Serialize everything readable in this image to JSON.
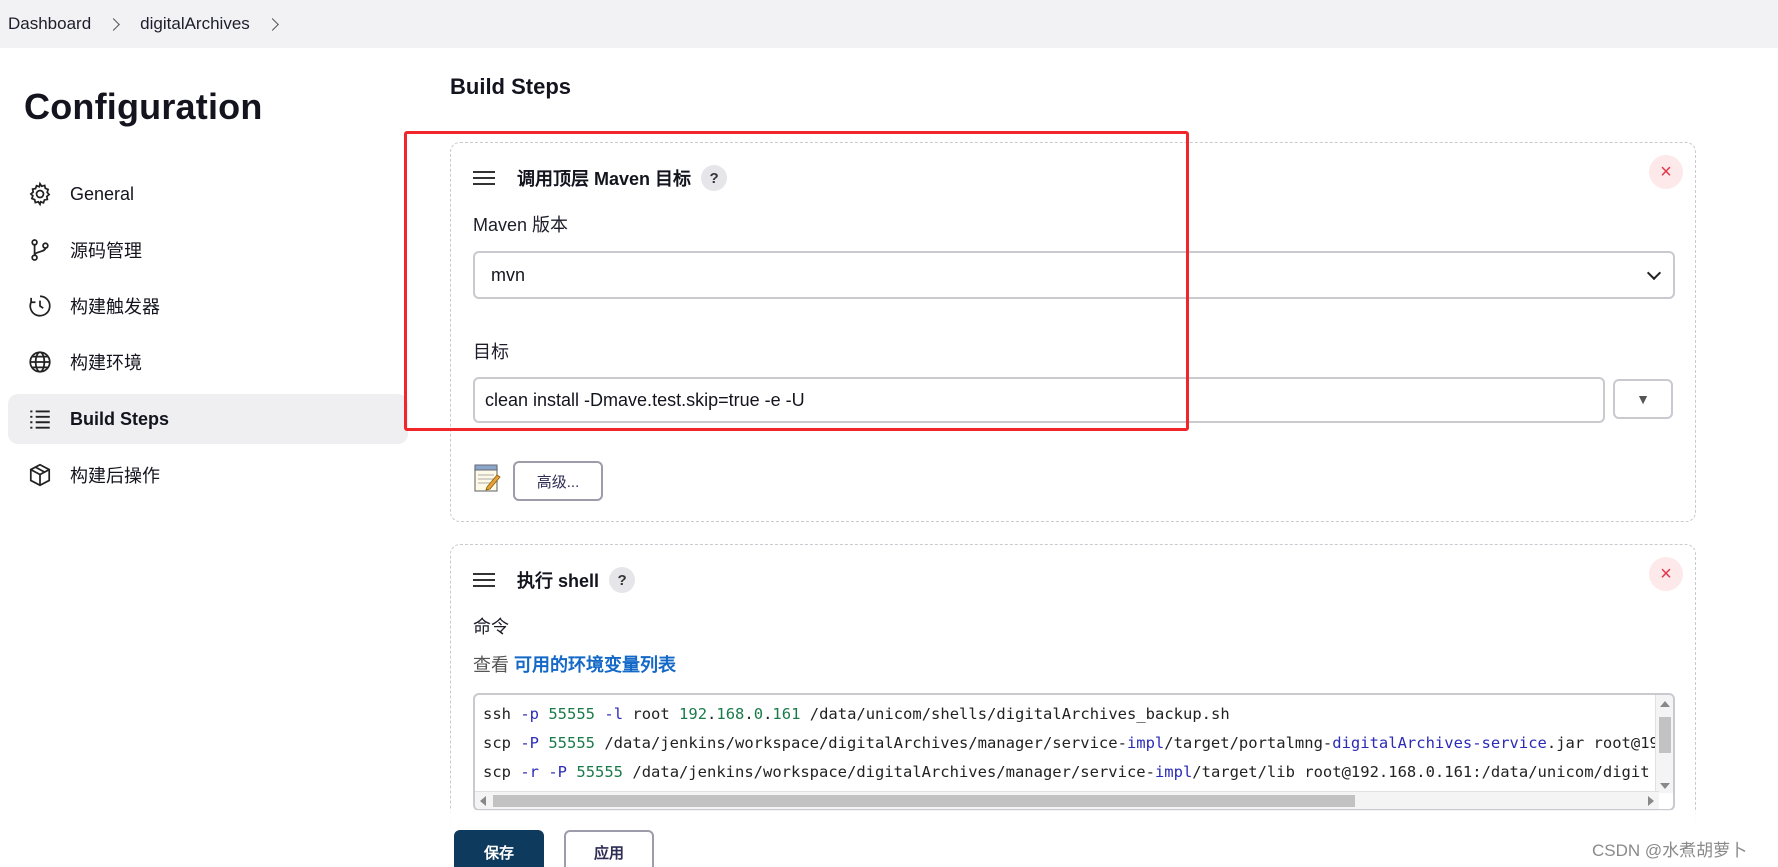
{
  "breadcrumb": {
    "items": [
      "Dashboard",
      "digitalArchives"
    ]
  },
  "sidebar": {
    "title": "Configuration",
    "items": [
      {
        "label": "General",
        "icon": "gear-icon"
      },
      {
        "label": "源码管理",
        "icon": "branch-icon"
      },
      {
        "label": "构建触发器",
        "icon": "clock-icon"
      },
      {
        "label": "构建环境",
        "icon": "globe-icon"
      },
      {
        "label": "Build Steps",
        "icon": "list-icon",
        "active": true
      },
      {
        "label": "构建后操作",
        "icon": "package-icon"
      }
    ]
  },
  "main": {
    "section_title": "Build Steps",
    "maven_step": {
      "title": "调用顶层 Maven 目标",
      "help": "?",
      "close": "×",
      "version_label": "Maven 版本",
      "version_value": "mvn",
      "goals_label": "目标",
      "goals_value": "clean install -Dmave.test.skip=true -e -U",
      "expand_symbol": "▼",
      "advanced_label": "高级..."
    },
    "shell_step": {
      "title": "执行 shell",
      "help": "?",
      "close": "×",
      "command_label": "命令",
      "env_prefix": "查看 ",
      "env_link": "可用的环境变量列表",
      "code_lines": [
        "ssh -p 55555 -l root 192.168.0.161 /data/unicom/shells/digitalArchives_backup.sh",
        "scp -P 55555 /data/jenkins/workspace/digitalArchives/manager/service-impl/target/portalmng-digitalArchives-service.jar root@19",
        "scp -r -P 55555 /data/jenkins/workspace/digitalArchives/manager/service-impl/target/lib  root@192.168.0.161:/data/unicom/digit"
      ]
    }
  },
  "footer": {
    "save_label": "保存",
    "apply_label": "应用"
  },
  "watermark": "CSDN @水煮胡萝卜",
  "colors": {
    "highlight": "#f0262b",
    "link": "#1469c8",
    "save_button": "#0e3a5d",
    "close_button": "#e0364a"
  }
}
